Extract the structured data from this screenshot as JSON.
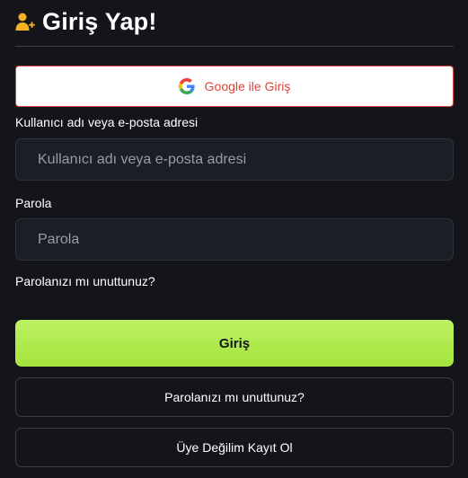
{
  "header": {
    "title": "Giriş Yap!",
    "icon": "user-plus-icon",
    "icon_color": "#f5b324"
  },
  "google_button": {
    "label": "Google ile Giriş",
    "icon": "google-icon",
    "text_color": "#d9463b"
  },
  "username": {
    "label": "Kullanıcı adı veya e-posta adresi",
    "placeholder": "Kullanıcı adı veya e-posta adresi",
    "value": ""
  },
  "password": {
    "label": "Parola",
    "placeholder": "Parola",
    "value": ""
  },
  "forgot_link": "Parolanızı mı unuttunuz?",
  "login_button": {
    "label": "Giriş",
    "color": "#b0ea4d"
  },
  "forgot_button": "Parolanızı mı unuttunuz?",
  "register_button": "Üye Değilim Kayıt Ol"
}
